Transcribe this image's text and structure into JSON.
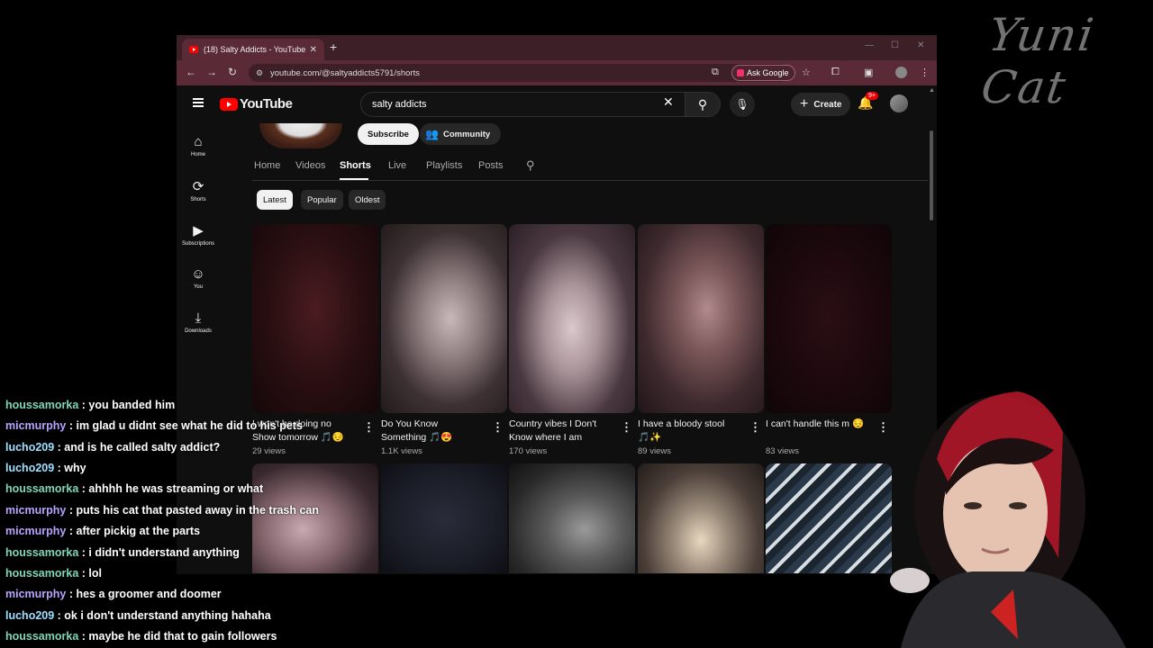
{
  "browser": {
    "tab_title": "(18) Salty Addicts - YouTube",
    "url": "youtube.com/@saltyaddicts5791/shorts",
    "ask_google": "Ask Google"
  },
  "youtube": {
    "logo": "YouTube",
    "search_value": "salty addicts",
    "create_label": "Create",
    "notif_count": "9+",
    "sidebar": [
      {
        "label": "Home",
        "icon": "home-icon"
      },
      {
        "label": "Shorts",
        "icon": "shorts-icon"
      },
      {
        "label": "Subscriptions",
        "icon": "subscriptions-icon"
      },
      {
        "label": "You",
        "icon": "you-icon"
      },
      {
        "label": "Downloads",
        "icon": "downloads-icon"
      }
    ],
    "subscribe_label": "Subscribe",
    "community_label": "Community",
    "tabs": [
      "Home",
      "Videos",
      "Shorts",
      "Live",
      "Playlists",
      "Posts"
    ],
    "active_tab": "Shorts",
    "chips": [
      "Latest",
      "Popular",
      "Oldest"
    ],
    "shorts": [
      {
        "title_line1": "I won't be doing no",
        "title_line2": "Show tomorrow 🎵😔",
        "views": "29 views"
      },
      {
        "title_line1": "Do You Know",
        "title_line2": "Something 🎵😍",
        "views": "1.1K views"
      },
      {
        "title_line1": "Country vibes I Don't",
        "title_line2": "Know where I am",
        "views": "170 views"
      },
      {
        "title_line1": "I have a bloody stool",
        "title_line2": "🎵✨",
        "views": "89 views"
      },
      {
        "title_line1": "I can't  handle this m 😔",
        "title_line2": "",
        "views": "83 views"
      }
    ]
  },
  "chat": [
    {
      "user": "houssamorka",
      "text": " : you banded him"
    },
    {
      "user": "micmurphy",
      "text": " : im glad u didnt see what he did to his pets"
    },
    {
      "user": "lucho209",
      "text": " : and is he called salty addict?"
    },
    {
      "user": "lucho209",
      "text": " : why"
    },
    {
      "user": "houssamorka",
      "text": " : ahhhh he was streaming or what"
    },
    {
      "user": "micmurphy",
      "text": " : puts his cat that pasted away in the trash can"
    },
    {
      "user": "micmurphy",
      "text": " : after pickig at the parts"
    },
    {
      "user": "houssamorka",
      "text": " : i didn't understand anything"
    },
    {
      "user": "houssamorka",
      "text": " : lol"
    },
    {
      "user": "micmurphy",
      "text": " : hes a groomer and doomer"
    },
    {
      "user": "lucho209",
      "text": " : ok i don't understand anything hahaha"
    },
    {
      "user": "houssamorka",
      "text": " : maybe he did that to gain followers"
    }
  ],
  "watermark": "Yuni Cat"
}
